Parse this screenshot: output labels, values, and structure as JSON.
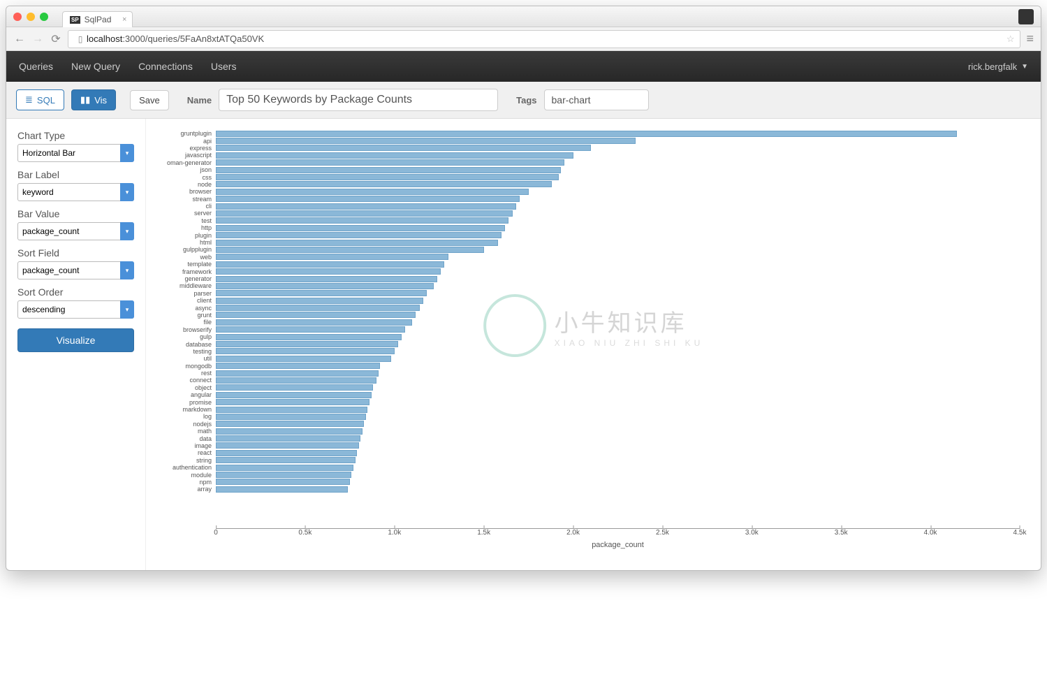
{
  "browser": {
    "tab_title": "SqlPad",
    "url_host": "localhost",
    "url_path": ":3000/queries/5FaAn8xtATQa50VK"
  },
  "nav": {
    "items": [
      "Queries",
      "New Query",
      "Connections",
      "Users"
    ],
    "user": "rick.bergfalk"
  },
  "toolbar": {
    "sql_label": "SQL",
    "vis_label": "Vis",
    "save_label": "Save",
    "name_label": "Name",
    "name_value": "Top 50 Keywords by Package Counts",
    "tags_label": "Tags",
    "tags_value": "bar-chart"
  },
  "sidebar": {
    "chart_type_label": "Chart Type",
    "chart_type_value": "Horizontal Bar",
    "bar_label_label": "Bar Label",
    "bar_label_value": "keyword",
    "bar_value_label": "Bar Value",
    "bar_value_value": "package_count",
    "sort_field_label": "Sort Field",
    "sort_field_value": "package_count",
    "sort_order_label": "Sort Order",
    "sort_order_value": "descending",
    "visualize_label": "Visualize"
  },
  "chart_data": {
    "type": "bar",
    "orientation": "horizontal",
    "xlabel": "package_count",
    "xlim": [
      0,
      4500
    ],
    "xticks": [
      0,
      500,
      1000,
      1500,
      2000,
      2500,
      3000,
      3500,
      4000,
      4500
    ],
    "xtick_labels": [
      "0",
      "0.5k",
      "1.0k",
      "1.5k",
      "2.0k",
      "2.5k",
      "3.0k",
      "3.5k",
      "4.0k",
      "4.5k"
    ],
    "categories": [
      "gruntplugin",
      "api",
      "express",
      "javascript",
      "oman-generator",
      "json",
      "css",
      "node",
      "browser",
      "stream",
      "cli",
      "server",
      "test",
      "http",
      "plugin",
      "html",
      "gulpplugin",
      "web",
      "template",
      "framework",
      "generator",
      "middleware",
      "parser",
      "client",
      "async",
      "grunt",
      "file",
      "browserify",
      "gulp",
      "database",
      "testing",
      "util",
      "mongodb",
      "rest",
      "connect",
      "object",
      "angular",
      "promise",
      "markdown",
      "log",
      "nodejs",
      "math",
      "data",
      "image",
      "react",
      "string",
      "authentication",
      "module",
      "npm",
      "array"
    ],
    "values": [
      4150,
      2350,
      2100,
      2000,
      1950,
      1930,
      1920,
      1880,
      1750,
      1700,
      1680,
      1660,
      1640,
      1620,
      1600,
      1580,
      1500,
      1300,
      1280,
      1260,
      1240,
      1220,
      1180,
      1160,
      1140,
      1120,
      1100,
      1060,
      1040,
      1020,
      1000,
      980,
      920,
      910,
      900,
      880,
      870,
      860,
      850,
      840,
      830,
      820,
      810,
      800,
      790,
      780,
      770,
      760,
      750,
      740
    ]
  },
  "watermark": {
    "cn": "小牛知识库",
    "en": "XIAO NIU ZHI SHI KU"
  }
}
